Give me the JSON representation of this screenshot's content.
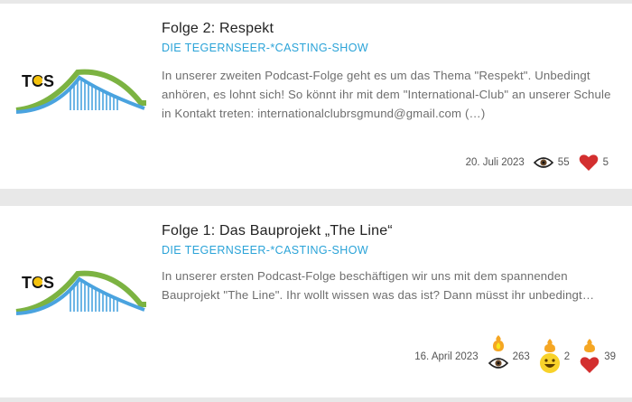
{
  "episodes": [
    {
      "title": "Folge 2: Respekt",
      "show": "DIE TEGERNSEER-*CASTING-SHOW",
      "description": "In unserer zweiten Podcast-Folge geht es um das Thema \"Respekt\". Unbedingt anhören, es lohnt sich! So könnt ihr mit dem \"International-Club\" an unserer Schule in Kontakt treten: internationalclubrsgmund@gmail.com (…)",
      "date": "20. Juli 2023",
      "views": "55",
      "likes": "5",
      "logo_text": "TCS"
    },
    {
      "title": "Folge 1: Das Bauprojekt „The Line“",
      "show": "DIE TEGERNSEER-*CASTING-SHOW",
      "description": "In unserer ersten Podcast-Folge beschäftigen wir uns mit dem spannenden Bauprojekt \"The Line\". Ihr wollt wissen was das ist? Dann müsst ihr unbedingt reinhören!",
      "date": "16. April 2023",
      "views": "263",
      "smiles": "2",
      "likes": "39",
      "logo_text": "TCS"
    }
  ],
  "colors": {
    "accent": "#2aa3d8",
    "heart": "#d32f2f",
    "logo_blue": "#4aa3df",
    "logo_green": "#7cb342"
  },
  "icons": [
    "eye-icon",
    "heart-icon",
    "smiley-icon",
    "flame-badge-icon"
  ]
}
